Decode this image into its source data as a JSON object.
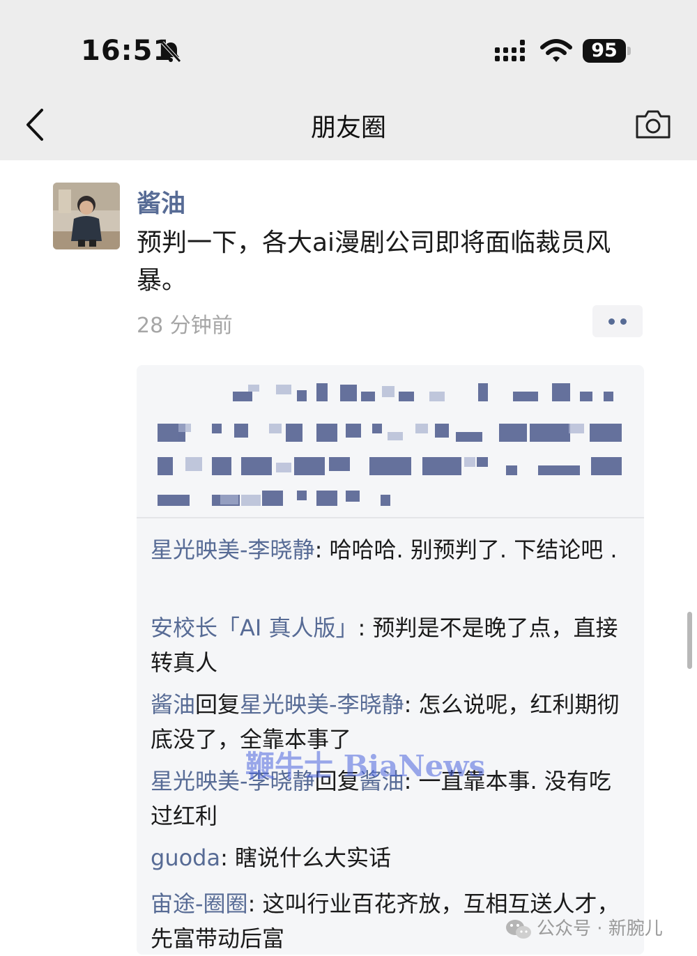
{
  "status_bar": {
    "time": "16:51",
    "battery": "95"
  },
  "nav": {
    "title": "朋友圈"
  },
  "post": {
    "author": "酱油",
    "text": "预判一下，各大ai漫剧公司即将面临裁员风暴。",
    "time": "28 分钟前"
  },
  "comments": [
    {
      "name": "星光映美-李晓静",
      "reply_word": "",
      "reply_to": "",
      "text": ": 哈哈哈. 别预判了. 下结论吧 ."
    },
    {
      "name": "安校长「AI 真人版」",
      "reply_word": "",
      "reply_to": "",
      "text": ": 预判是不是晚了点，直接转真人"
    },
    {
      "name": "酱油",
      "reply_word": "回复",
      "reply_to": "星光映美-李晓静",
      "text": ": 怎么说呢，红利期彻底没了，全靠本事了"
    },
    {
      "name": "星光映美-李晓静",
      "reply_word": "回复",
      "reply_to": "酱油",
      "text": ": 一直靠本事. 没有吃过红利"
    },
    {
      "name": "guoda",
      "reply_word": "",
      "reply_to": "",
      "text": ": 瞎说什么大实话"
    },
    {
      "name": "宙途-圈圈",
      "reply_word": "",
      "reply_to": "",
      "text": ": 这叫行业百花齐放，互相互送人才，先富带动后富"
    }
  ],
  "watermark": "鞭牛士 BiaNews",
  "source_label": "公众号 · 新腕儿",
  "icons": [
    "mute-bell-icon",
    "signal-icon",
    "wifi-icon",
    "back-chevron-icon",
    "camera-icon",
    "more-dots-icon",
    "wechat-icon"
  ],
  "colors": {
    "link": "#576b95",
    "header_bg": "#ededed",
    "comment_bg": "#f5f6f8",
    "meta": "#a6a6a6"
  }
}
